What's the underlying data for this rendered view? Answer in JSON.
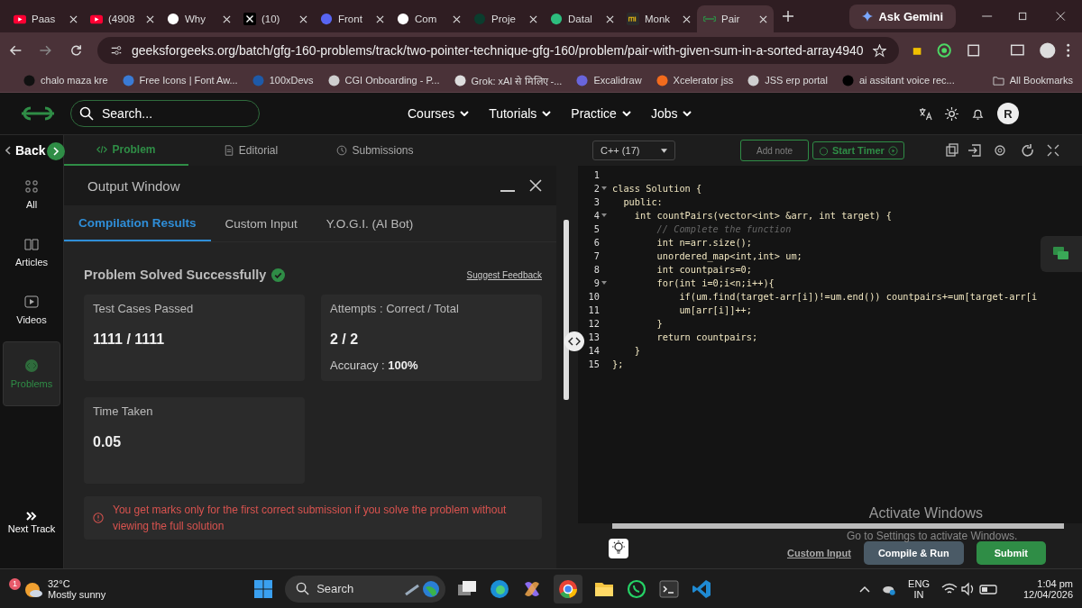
{
  "browser": {
    "tabs": [
      {
        "title": "Paas",
        "kind": "youtube",
        "selected": false
      },
      {
        "title": "(4908",
        "kind": "youtube",
        "selected": false
      },
      {
        "title": "Why",
        "kind": "chat",
        "selected": false
      },
      {
        "title": "(10)",
        "kind": "x",
        "selected": false
      },
      {
        "title": "Front",
        "kind": "frame",
        "selected": false
      },
      {
        "title": "Com",
        "kind": "github",
        "selected": false
      },
      {
        "title": "Proje",
        "kind": "leaf",
        "selected": false
      },
      {
        "title": "Datal",
        "kind": "spiral",
        "selected": false
      },
      {
        "title": "Monk",
        "kind": "mt",
        "selected": false
      },
      {
        "title": "Pair",
        "kind": "gfg",
        "selected": true
      }
    ],
    "gemini": "Ask Gemini",
    "url": "geeksforgeeks.org/batch/gfg-160-problems/track/two-pointer-technique-gfg-160/problem/pair-with-given-sum-in-a-sorted-array4940",
    "bookmarks": [
      {
        "title": "chalo maza kre",
        "kind": "tuf"
      },
      {
        "title": "Free Icons | Font Aw...",
        "kind": "flag"
      },
      {
        "title": "100xDevs",
        "kind": "person"
      },
      {
        "title": "CGI Onboarding - P...",
        "kind": "globe"
      },
      {
        "title": "Grok: xAI से मिलिए -...",
        "kind": "grok"
      },
      {
        "title": "Excalidraw",
        "kind": "excali"
      },
      {
        "title": "Xcelerator jss",
        "kind": "xcel"
      },
      {
        "title": "JSS erp portal",
        "kind": "globe"
      },
      {
        "title": "ai assitant voice rec...",
        "kind": "b"
      }
    ],
    "all_bookmarks": "All Bookmarks"
  },
  "site": {
    "search_placeholder": "Search...",
    "nav": [
      "Courses",
      "Tutorials",
      "Practice",
      "Jobs"
    ],
    "avatar": "R"
  },
  "sidebar": {
    "back": "Back",
    "items": [
      {
        "label": "All",
        "kind": "all",
        "selected": false
      },
      {
        "label": "Articles",
        "kind": "book",
        "selected": false
      },
      {
        "label": "Videos",
        "kind": "play",
        "selected": false
      },
      {
        "label": "Problems",
        "kind": "code",
        "selected": true
      }
    ],
    "next": "Next Track"
  },
  "problem_tabs": [
    {
      "label": "Problem",
      "kind": "code",
      "selected": true
    },
    {
      "label": "Editorial",
      "kind": "doc",
      "selected": false
    },
    {
      "label": "Submissions",
      "kind": "clock",
      "selected": false
    }
  ],
  "output_window": {
    "title": "Output Window",
    "tabs": [
      {
        "label": "Compilation Results",
        "selected": true
      },
      {
        "label": "Custom Input",
        "selected": false
      },
      {
        "label": "Y.O.G.I. (AI Bot)",
        "selected": false
      }
    ],
    "status": "Problem Solved Successfully",
    "feedback": "Suggest Feedback",
    "cards": [
      {
        "label": "Test Cases Passed",
        "value": "1111 / 1111"
      },
      {
        "label": "Attempts : Correct / Total",
        "value": "2 / 2",
        "extra_label": "Accuracy :",
        "extra_value": "100%"
      },
      {
        "label": "Time Taken",
        "value": "0.05"
      }
    ],
    "notice": "You get marks only for the first correct submission if you solve the problem without viewing the full solution"
  },
  "editor": {
    "language": "C++ (17)",
    "add_note": "Add note",
    "timer": "Start Timer",
    "lines": [
      {
        "num": "1",
        "fold": false,
        "kind": "blank"
      },
      {
        "num": "2",
        "text": "class Solution {",
        "fold": true,
        "kind": "code"
      },
      {
        "num": "3",
        "text": "  public:",
        "fold": false,
        "kind": "code"
      },
      {
        "num": "4",
        "text": "    int countPairs(vector<int> &arr, int target) {",
        "fold": true,
        "kind": "code"
      },
      {
        "num": "5",
        "text": "        // Complete the function",
        "fold": false,
        "kind": "comment"
      },
      {
        "num": "6",
        "text": "        int n=arr.size();",
        "fold": false,
        "kind": "code"
      },
      {
        "num": "7",
        "text": "        unordered_map<int,int> um;",
        "fold": false,
        "kind": "code"
      },
      {
        "num": "8",
        "text": "        int countpairs=0;",
        "fold": false,
        "kind": "code"
      },
      {
        "num": "9",
        "text": "        for(int i=0;i<n;i++){",
        "fold": true,
        "kind": "code"
      },
      {
        "num": "10",
        "text": "            if(um.find(target-arr[i])!=um.end()) countpairs+=um[target-arr[i",
        "fold": false,
        "kind": "code"
      },
      {
        "num": "11",
        "text": "            um[arr[i]]++;",
        "fold": false,
        "kind": "code"
      },
      {
        "num": "12",
        "text": "        }",
        "fold": false,
        "kind": "code"
      },
      {
        "num": "13",
        "text": "        return countpairs;",
        "fold": false,
        "kind": "code"
      },
      {
        "num": "14",
        "text": "    }",
        "fold": false,
        "kind": "code"
      },
      {
        "num": "15",
        "text": "};",
        "fold": false,
        "kind": "code"
      }
    ],
    "custom_input": "Custom Input",
    "compile": "Compile & Run",
    "submit": "Submit"
  },
  "activation": {
    "title": "Activate Windows",
    "hint": "Go to Settings to activate Windows."
  },
  "taskbar": {
    "temperature": "32°C",
    "weather": "Mostly sunny",
    "weather_badge": "1",
    "search": "Search",
    "language": "ENG",
    "region": "IN",
    "time": "1:04 pm",
    "date": "12/04/2026"
  }
}
